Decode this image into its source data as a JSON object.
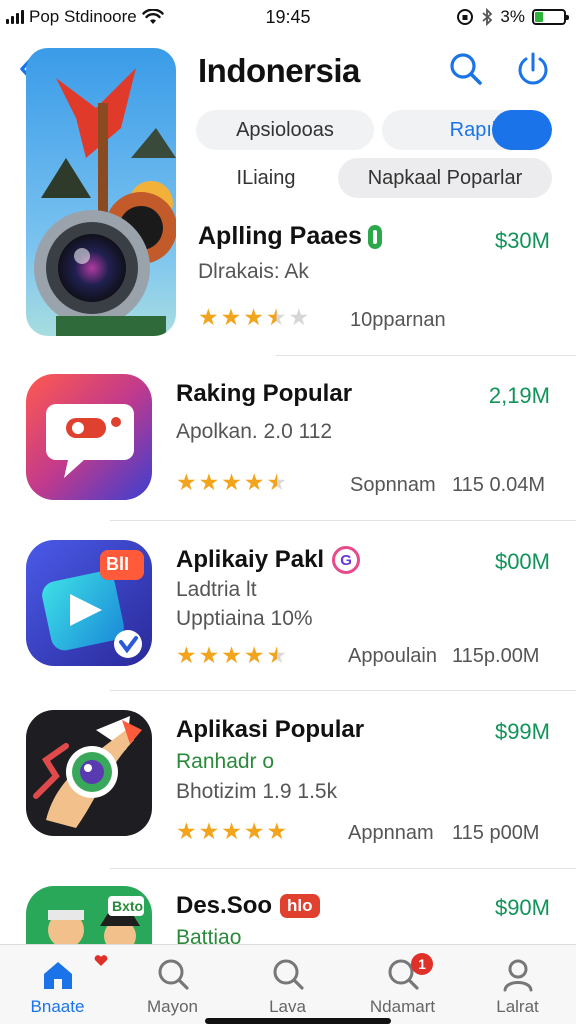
{
  "status_bar": {
    "carrier": "Pop Stdinoore",
    "time": "19:45",
    "battery": "3%",
    "battery_level": 0.3
  },
  "header": {
    "title": "Indonersia",
    "back_icon": "chevron-left-icon",
    "search_icon": "search-icon",
    "power_icon": "power-icon"
  },
  "filters": {
    "chip1": "Apsiolooas",
    "chip2": "Rapıl",
    "chip3": "ILiaing",
    "chip4": "Napkaal Poparlar"
  },
  "featured": {
    "title": "Aplling Paaes",
    "price": "$30M",
    "subtitle": "Dlrakais: Ak",
    "rating": 3.5,
    "meta": "10pparnan"
  },
  "apps": [
    {
      "title": "Raking Popular",
      "price": "2,19M",
      "line1": "Apolkan. 2.0 112",
      "rating": 4.5,
      "meta1": "Sopnnam",
      "meta2": "115 0.04M"
    },
    {
      "title": "Aplikaiy Pakl",
      "badge": "G",
      "price": "$00M",
      "line1": "Ladtria lt",
      "line2": "Upptiaina 10%",
      "rating": 4.5,
      "meta1": "Appoulain",
      "meta2": "115p.00M",
      "icon_badge": "BlI"
    },
    {
      "title": "Aplikasi Popular",
      "price": "$99M",
      "line1": "Ranhadr o",
      "line2": "Bhotizim 1.9 1.5k",
      "rating": 5,
      "meta1": "Appnnam",
      "meta2": "115 p00M"
    },
    {
      "title": "Des.Soo",
      "badge": "hlo",
      "price": "$90M",
      "line1": "Battiao",
      "icon_badge": "Bxto"
    }
  ],
  "tabs": [
    {
      "label": "Bnaate",
      "icon": "home-icon",
      "active": true
    },
    {
      "label": "Mayon",
      "icon": "search-icon",
      "active": false
    },
    {
      "label": "Lava",
      "icon": "search-icon",
      "active": false
    },
    {
      "label": "Ndamart",
      "icon": "search-icon",
      "active": false,
      "badge": "1"
    },
    {
      "label": "Lalrat",
      "icon": "person-icon",
      "active": false
    }
  ],
  "colors": {
    "accent": "#1a73e8",
    "price_green": "#11935a",
    "star": "#f2a51c"
  }
}
